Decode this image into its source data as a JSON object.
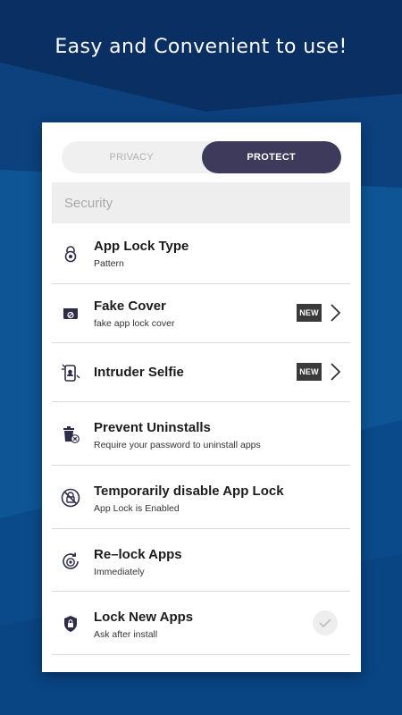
{
  "headline": "Easy and Convenient to use!",
  "tabs": {
    "privacy": "PRIVACY",
    "protect": "PROTECT",
    "active": "PROTECT"
  },
  "section": {
    "title": "Security"
  },
  "items": [
    {
      "title": "App Lock Type",
      "subtitle": "Pattern",
      "icon": "lock-icon"
    },
    {
      "title": "Fake Cover",
      "subtitle": "fake app lock cover",
      "icon": "fake-cover-icon",
      "badge": "NEW"
    },
    {
      "title": "Intruder Selfie",
      "icon": "intruder-selfie-icon",
      "badge": "NEW"
    },
    {
      "title": "Prevent Uninstalls",
      "subtitle": "Require your password to uninstall apps",
      "icon": "trash-icon"
    },
    {
      "title": "Temporarily disable App Lock",
      "subtitle": "App Lock is Enabled",
      "icon": "disable-lock-icon"
    },
    {
      "title": "Re–lock Apps",
      "subtitle": "Immediately",
      "icon": "relock-icon"
    },
    {
      "title": "Lock New Apps",
      "subtitle": "Ask after install",
      "icon": "shield-lock-icon",
      "checked": false
    }
  ],
  "colors": {
    "background": "#0d4f90",
    "tab_active": "#3e3a5c",
    "badge": "#3a3a3a"
  }
}
